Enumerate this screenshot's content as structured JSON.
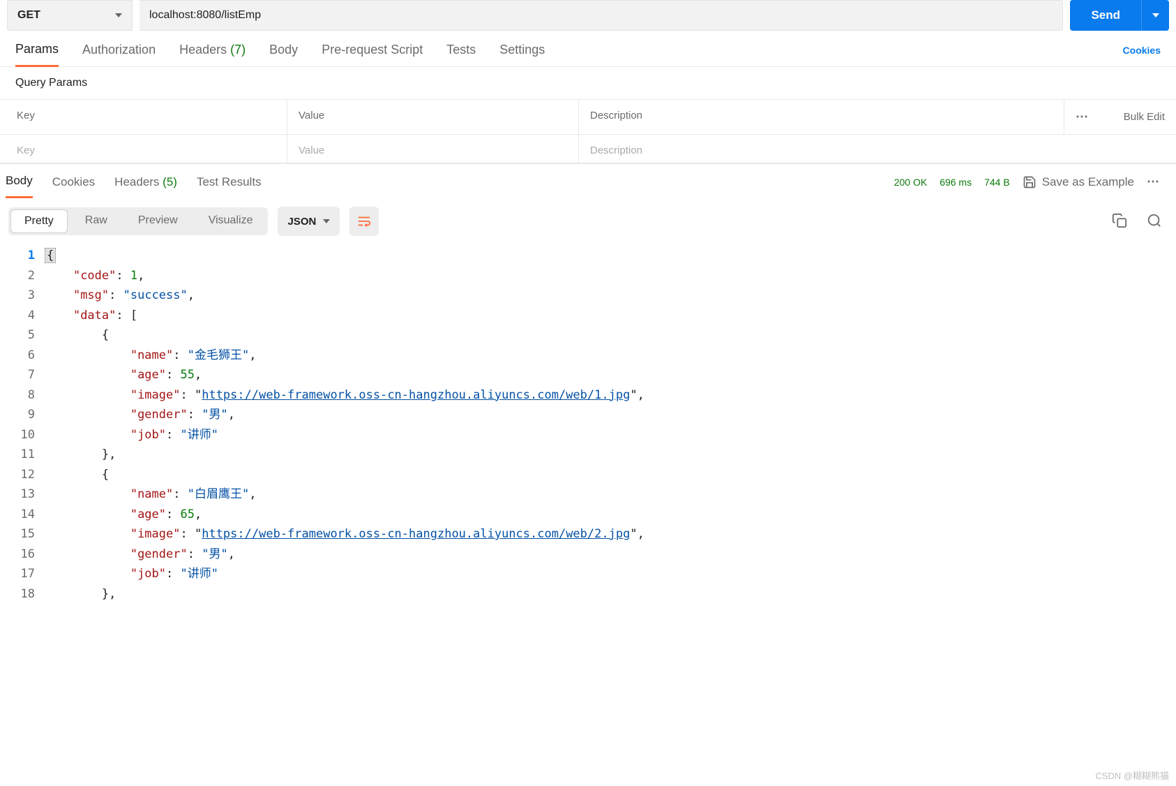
{
  "request": {
    "method": "GET",
    "url": "localhost:8080/listEmp",
    "send_label": "Send"
  },
  "req_tabs": {
    "params": "Params",
    "authorization": "Authorization",
    "headers": "Headers",
    "headers_count": "(7)",
    "body": "Body",
    "prerequest": "Pre-request Script",
    "tests": "Tests",
    "settings": "Settings",
    "cookies": "Cookies"
  },
  "query_params": {
    "title": "Query Params",
    "head_key": "Key",
    "head_value": "Value",
    "head_desc": "Description",
    "bulk_edit": "Bulk Edit",
    "ph_key": "Key",
    "ph_value": "Value",
    "ph_desc": "Description"
  },
  "resp_tabs": {
    "body": "Body",
    "cookies": "Cookies",
    "headers": "Headers",
    "headers_count": "(5)",
    "test_results": "Test Results"
  },
  "response_meta": {
    "status": "200 OK",
    "time": "696 ms",
    "size": "744 B",
    "save_example": "Save as Example"
  },
  "view_tabs": {
    "pretty": "Pretty",
    "raw": "Raw",
    "preview": "Preview",
    "visualize": "Visualize",
    "type": "JSON"
  },
  "code": {
    "current_line": "1",
    "lines": [
      "1",
      "2",
      "3",
      "4",
      "5",
      "6",
      "7",
      "8",
      "9",
      "10",
      "11",
      "12",
      "13",
      "14",
      "15",
      "16",
      "17",
      "18"
    ],
    "json": {
      "code": 1,
      "msg": "success",
      "data": [
        {
          "name": "金毛狮王",
          "age": 55,
          "image": "https://web-framework.oss-cn-hangzhou.aliyuncs.com/web/1.jpg",
          "gender": "男",
          "job": "讲师"
        },
        {
          "name": "白眉鹰王",
          "age": 65,
          "image": "https://web-framework.oss-cn-hangzhou.aliyuncs.com/web/2.jpg",
          "gender": "男",
          "job": "讲师"
        }
      ]
    }
  },
  "watermark": "CSDN @糊糊熊猫"
}
